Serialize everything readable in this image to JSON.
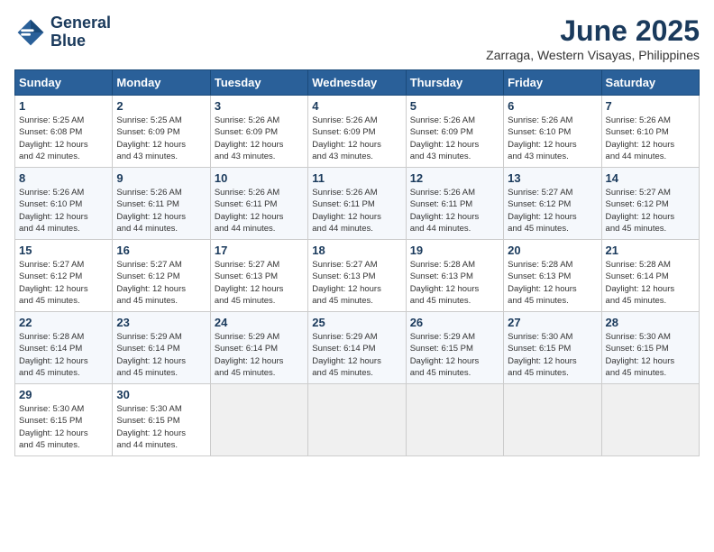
{
  "header": {
    "logo_line1": "General",
    "logo_line2": "Blue",
    "month_title": "June 2025",
    "location": "Zarraga, Western Visayas, Philippines"
  },
  "calendar": {
    "days_of_week": [
      "Sunday",
      "Monday",
      "Tuesday",
      "Wednesday",
      "Thursday",
      "Friday",
      "Saturday"
    ],
    "weeks": [
      [
        null,
        {
          "day": "2",
          "sunrise": "5:25 AM",
          "sunset": "6:09 PM",
          "daylight": "12 hours and 43 minutes."
        },
        {
          "day": "3",
          "sunrise": "5:26 AM",
          "sunset": "6:09 PM",
          "daylight": "12 hours and 43 minutes."
        },
        {
          "day": "4",
          "sunrise": "5:26 AM",
          "sunset": "6:09 PM",
          "daylight": "12 hours and 43 minutes."
        },
        {
          "day": "5",
          "sunrise": "5:26 AM",
          "sunset": "6:09 PM",
          "daylight": "12 hours and 43 minutes."
        },
        {
          "day": "6",
          "sunrise": "5:26 AM",
          "sunset": "6:10 PM",
          "daylight": "12 hours and 43 minutes."
        },
        {
          "day": "7",
          "sunrise": "5:26 AM",
          "sunset": "6:10 PM",
          "daylight": "12 hours and 44 minutes."
        }
      ],
      [
        {
          "day": "1",
          "sunrise": "5:25 AM",
          "sunset": "6:08 PM",
          "daylight": "12 hours and 42 minutes."
        },
        null,
        null,
        null,
        null,
        null,
        null
      ],
      [
        {
          "day": "8",
          "sunrise": "5:26 AM",
          "sunset": "6:10 PM",
          "daylight": "12 hours and 44 minutes."
        },
        {
          "day": "9",
          "sunrise": "5:26 AM",
          "sunset": "6:11 PM",
          "daylight": "12 hours and 44 minutes."
        },
        {
          "day": "10",
          "sunrise": "5:26 AM",
          "sunset": "6:11 PM",
          "daylight": "12 hours and 44 minutes."
        },
        {
          "day": "11",
          "sunrise": "5:26 AM",
          "sunset": "6:11 PM",
          "daylight": "12 hours and 44 minutes."
        },
        {
          "day": "12",
          "sunrise": "5:26 AM",
          "sunset": "6:11 PM",
          "daylight": "12 hours and 44 minutes."
        },
        {
          "day": "13",
          "sunrise": "5:27 AM",
          "sunset": "6:12 PM",
          "daylight": "12 hours and 45 minutes."
        },
        {
          "day": "14",
          "sunrise": "5:27 AM",
          "sunset": "6:12 PM",
          "daylight": "12 hours and 45 minutes."
        }
      ],
      [
        {
          "day": "15",
          "sunrise": "5:27 AM",
          "sunset": "6:12 PM",
          "daylight": "12 hours and 45 minutes."
        },
        {
          "day": "16",
          "sunrise": "5:27 AM",
          "sunset": "6:12 PM",
          "daylight": "12 hours and 45 minutes."
        },
        {
          "day": "17",
          "sunrise": "5:27 AM",
          "sunset": "6:13 PM",
          "daylight": "12 hours and 45 minutes."
        },
        {
          "day": "18",
          "sunrise": "5:27 AM",
          "sunset": "6:13 PM",
          "daylight": "12 hours and 45 minutes."
        },
        {
          "day": "19",
          "sunrise": "5:28 AM",
          "sunset": "6:13 PM",
          "daylight": "12 hours and 45 minutes."
        },
        {
          "day": "20",
          "sunrise": "5:28 AM",
          "sunset": "6:13 PM",
          "daylight": "12 hours and 45 minutes."
        },
        {
          "day": "21",
          "sunrise": "5:28 AM",
          "sunset": "6:14 PM",
          "daylight": "12 hours and 45 minutes."
        }
      ],
      [
        {
          "day": "22",
          "sunrise": "5:28 AM",
          "sunset": "6:14 PM",
          "daylight": "12 hours and 45 minutes."
        },
        {
          "day": "23",
          "sunrise": "5:29 AM",
          "sunset": "6:14 PM",
          "daylight": "12 hours and 45 minutes."
        },
        {
          "day": "24",
          "sunrise": "5:29 AM",
          "sunset": "6:14 PM",
          "daylight": "12 hours and 45 minutes."
        },
        {
          "day": "25",
          "sunrise": "5:29 AM",
          "sunset": "6:14 PM",
          "daylight": "12 hours and 45 minutes."
        },
        {
          "day": "26",
          "sunrise": "5:29 AM",
          "sunset": "6:15 PM",
          "daylight": "12 hours and 45 minutes."
        },
        {
          "day": "27",
          "sunrise": "5:30 AM",
          "sunset": "6:15 PM",
          "daylight": "12 hours and 45 minutes."
        },
        {
          "day": "28",
          "sunrise": "5:30 AM",
          "sunset": "6:15 PM",
          "daylight": "12 hours and 45 minutes."
        }
      ],
      [
        {
          "day": "29",
          "sunrise": "5:30 AM",
          "sunset": "6:15 PM",
          "daylight": "12 hours and 45 minutes."
        },
        {
          "day": "30",
          "sunrise": "5:30 AM",
          "sunset": "6:15 PM",
          "daylight": "12 hours and 44 minutes."
        },
        null,
        null,
        null,
        null,
        null
      ]
    ]
  }
}
